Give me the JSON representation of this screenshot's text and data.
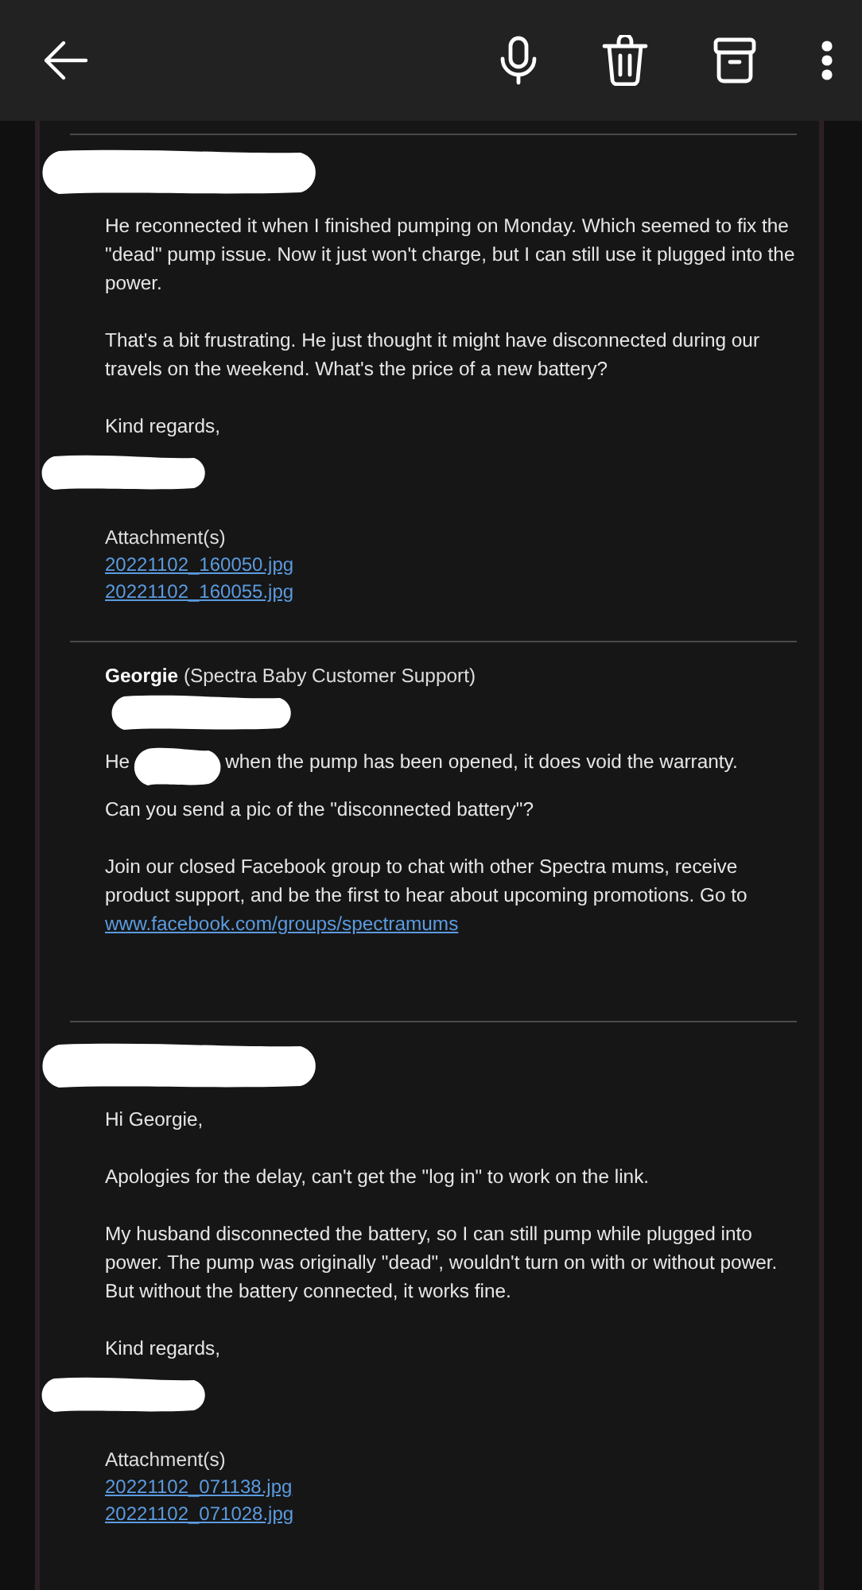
{
  "toolbar": {
    "buttons": [
      {
        "kind": "mic"
      },
      {
        "kind": "delete"
      },
      {
        "kind": "archive"
      },
      {
        "kind": "more"
      }
    ]
  },
  "messages": [
    {
      "sender_redacted": true,
      "paragraphs": [
        {
          "kind": "text",
          "text": "He reconnected it when I finished pumping on Monday. Which seemed to fix the \"dead\" pump issue. Now it just won't charge, but I can still use it plugged into the power."
        },
        {
          "kind": "text",
          "text": "That's a bit frustrating. He just thought it might have disconnected during our travels on the weekend. What's the price of a new battery?"
        },
        {
          "kind": "text",
          "text": "Kind regards,"
        }
      ],
      "signature_redacted": true,
      "attachments_label": "Attachment(s)",
      "attachments": [
        "20221102_160050.jpg",
        "20221102_160055.jpg"
      ]
    },
    {
      "sender": "Georgie",
      "sender_note": "(Spectra Baby Customer Support)",
      "detail_redacted": true,
      "paragraphs": [
        {
          "kind": "redacted",
          "before": "He",
          "after": "when the pump has been opened, it does void the warranty."
        },
        {
          "kind": "text",
          "text": "Can you send a pic of the \"disconnected battery\"?"
        },
        {
          "kind": "text",
          "text": "Join our closed Facebook group to chat with other Spectra mums, receive product support, and be the first to hear about upcoming promotions. Go to",
          "link": "www.facebook.com/groups/spectramums"
        }
      ]
    },
    {
      "sender_redacted": true,
      "paragraphs": [
        {
          "kind": "text",
          "text": "Hi Georgie,"
        },
        {
          "kind": "text",
          "text": "Apologies for the delay, can't get the \"log in\" to work on the link."
        },
        {
          "kind": "text",
          "text": "My husband disconnected the battery, so I can still pump while plugged into power. The pump was originally \"dead\", wouldn't turn on with or without power. But without the battery connected, it works fine."
        },
        {
          "kind": "text",
          "text": "Kind regards,"
        }
      ],
      "signature_redacted": true,
      "attachments_label": "Attachment(s)",
      "attachments": [
        "20221102_071138.jpg",
        "20221102_071028.jpg"
      ]
    }
  ]
}
